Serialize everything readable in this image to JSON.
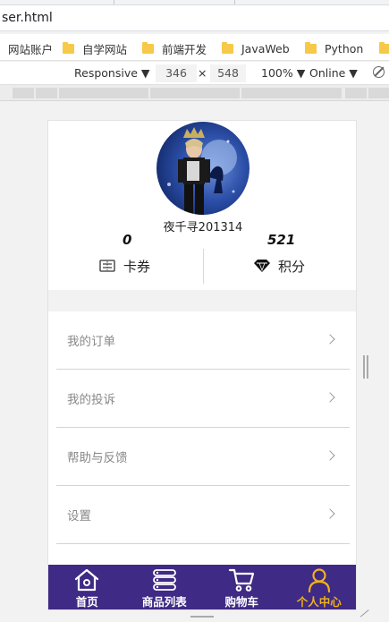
{
  "browser": {
    "address_text": "ser.html",
    "bookmarks": [
      "网站账户",
      "自学网站",
      "前端开发",
      "JavaWeb",
      "Python"
    ]
  },
  "devtools": {
    "device": "Responsive ▼",
    "width": "346",
    "times": "×",
    "height": "548",
    "zoom": "100% ▼",
    "network": "Online ▼"
  },
  "profile": {
    "username": "夜千寻201314",
    "stat_left": "0",
    "stat_right": "521",
    "action_left": "卡券",
    "action_right": "积分"
  },
  "menu": [
    {
      "label": "我的订单"
    },
    {
      "label": "我的投诉"
    },
    {
      "label": "帮助与反馈"
    },
    {
      "label": "设置"
    }
  ],
  "tabbar": {
    "items": [
      {
        "label": "首页",
        "icon": "home-icon"
      },
      {
        "label": "商品列表",
        "icon": "list-icon"
      },
      {
        "label": "购物车",
        "icon": "cart-icon"
      },
      {
        "label": "个人中心",
        "icon": "user-icon"
      }
    ],
    "active_index": 3,
    "background": "#3f2a85",
    "active_color": "#f0b21a"
  }
}
